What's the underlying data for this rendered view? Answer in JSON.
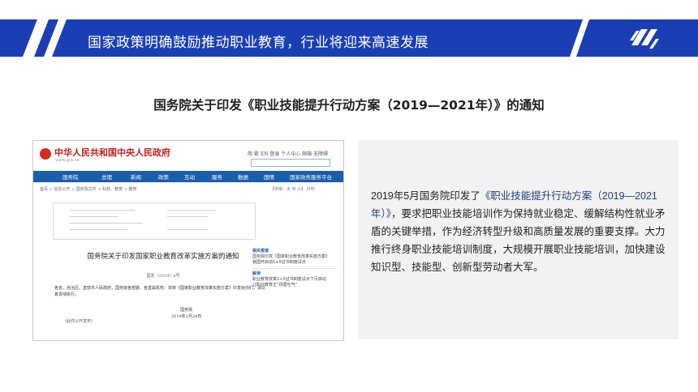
{
  "banner": {
    "title": "国家政策明确鼓励推动职业教育，行业将迎来高速发展",
    "color": "#1a3fb5"
  },
  "heading": "国务院关于印发《职业技能提升行动方案（2019—2021年）》的通知",
  "screenshot": {
    "site_title": "中华人民共和国中央人民政府",
    "site_url": "www.gov.cn",
    "top_icons": "简 繁 EN 登录 个人中心 邮箱 无障碍",
    "nav": [
      "国务院",
      "总理",
      "新闻",
      "政策",
      "互动",
      "服务",
      "数据",
      "国情",
      "国家政务服务平台"
    ],
    "breadcrumb": "首页 > 信息公开 > 国务院文件 > 科技、教育 > 教育",
    "crumb_right": "【字体：大 中 小】 打印",
    "doc_title": "国务院关于印发国家职业教育改革实施方案的通知",
    "doc_number": "国发〔2019〕4号",
    "doc_body": "各省、自治区、直辖市人民政府，国务院各部委、各直属机构：现将《国家职业教育改革实施方案》印发给你们，请认真贯彻执行。",
    "doc_sign": [
      "国务院",
      "2019年1月24日"
    ],
    "doc_foot": "（此件公开发布）",
    "related_heading": "相关报道",
    "related_items": [
      "国务院印发《国家职业教育改革实施方案》",
      "我国开启动1+X证书制度试点"
    ],
    "interpret_heading": "解读",
    "interpret_items": [
      "职业教育改革1+X证书制度试点下月启动",
      "让职业教育正“扬眉吐气”"
    ]
  },
  "paragraph": {
    "prefix": "2019年5月国务院印发了",
    "highlight": "《职业技能提升行动方案（2019—2021年）》",
    "rest": "，要求把职业技能培训作为保持就业稳定、缓解结构性就业矛盾的关键举措，作为经济转型升级和高质量发展的重要支撑。大力推行终身职业技能培训制度，大规模开展职业技能培训，加快建设知识型、技能型、创新型劳动者大军。",
    "highlight_color": "#1c3f7a"
  }
}
